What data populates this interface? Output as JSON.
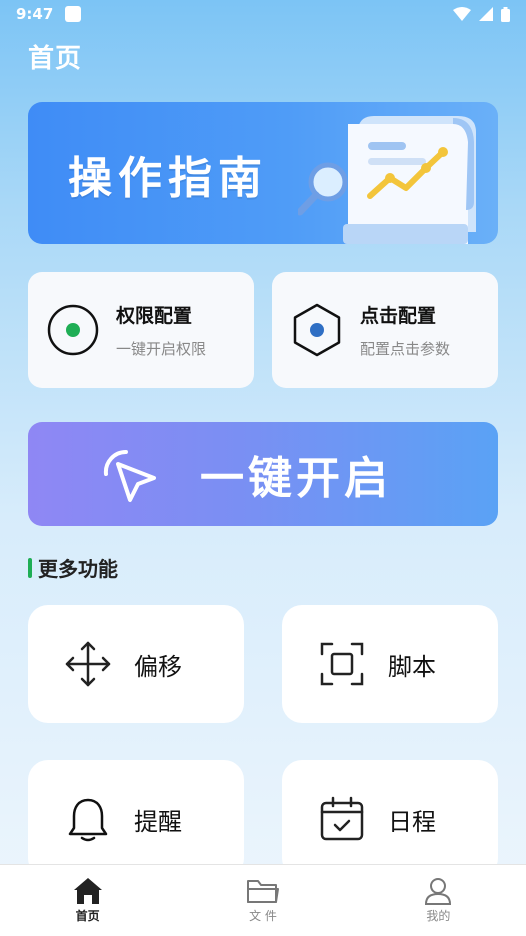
{
  "status_bar": {
    "time": "9:47"
  },
  "header": {
    "title": "首页"
  },
  "banner": {
    "title": "操作指南"
  },
  "config_cards": [
    {
      "title": "权限配置",
      "subtitle": "一键开启权限"
    },
    {
      "title": "点击配置",
      "subtitle": "配置点击参数"
    }
  ],
  "one_key": {
    "label": "一键开启"
  },
  "section": {
    "title": "更多功能"
  },
  "features": [
    {
      "label": "偏移",
      "icon": "move-arrows-icon"
    },
    {
      "label": "脚本",
      "icon": "scan-frame-icon"
    },
    {
      "label": "提醒",
      "icon": "bell-icon"
    },
    {
      "label": "日程",
      "icon": "calendar-check-icon"
    }
  ],
  "tabbar": {
    "items": [
      {
        "label": "首页",
        "icon": "home-icon",
        "active": true
      },
      {
        "label": "文 件",
        "icon": "folder-icon",
        "active": false
      },
      {
        "label": "我的",
        "icon": "user-icon",
        "active": false
      }
    ]
  },
  "colors": {
    "accent_green": "#1fae55",
    "accent_blue": "#2f6fc4",
    "banner_blue": "#3f8cf6",
    "one_key_purple": "#8f87f4"
  }
}
